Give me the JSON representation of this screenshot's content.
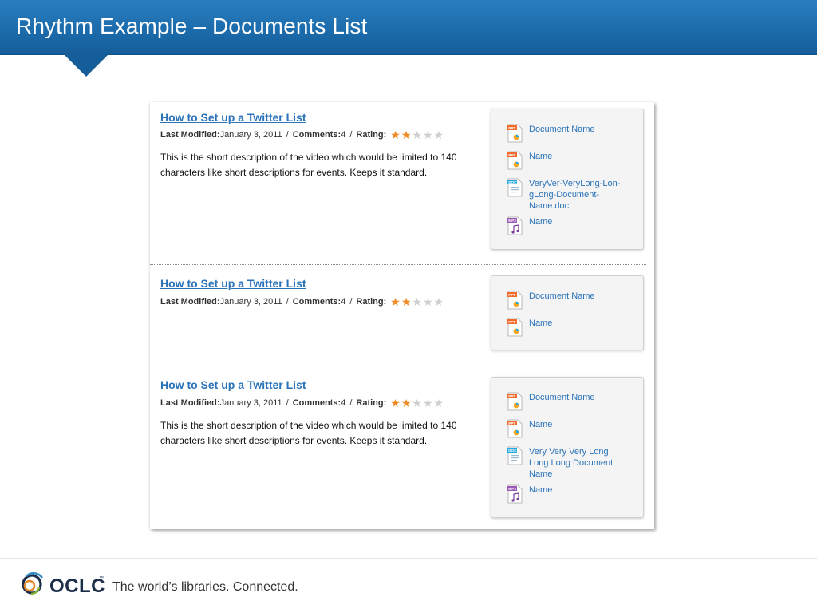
{
  "header": {
    "title": "Rhythm Example – Documents List"
  },
  "colors": {
    "header": "#1b6aaa",
    "link": "#2a73b8",
    "star_on": "#f08a24",
    "star_off": "#cfcfcf",
    "ppt": "#f26b2b",
    "doc": "#29a8e0",
    "mp3": "#9b59b6"
  },
  "items": [
    {
      "title": "How to Set up a Twitter List",
      "meta": {
        "modified_label": "Last Modified:",
        "modified_value": "January 3, 2011",
        "sep": "/",
        "comments_label": "Comments:",
        "comments_value": "4",
        "rating_label": "Rating:",
        "rating": 2,
        "rating_max": 5
      },
      "description": "This is the short description of the video which would be limited to 140 characters like short descriptions for events. Keeps it standard.",
      "documents": [
        {
          "type": "ppt",
          "icon": "ppt-file-icon",
          "badge": "PPT",
          "name": "Document Name"
        },
        {
          "type": "ppt",
          "icon": "ppt-file-icon",
          "badge": "PPT",
          "name": "Name"
        },
        {
          "type": "doc",
          "icon": "doc-file-icon",
          "badge": "DOC",
          "name": "VeryVer-VeryLong-Lon-gLong-Document-Name.doc"
        },
        {
          "type": "mp3",
          "icon": "mp3-file-icon",
          "badge": "MP3",
          "name": "Name"
        }
      ]
    },
    {
      "title": "How to Set up a Twitter List",
      "meta": {
        "modified_label": "Last Modified:",
        "modified_value": "January 3, 2011",
        "sep": "/",
        "comments_label": "Comments:",
        "comments_value": "4",
        "rating_label": "Rating:",
        "rating": 2,
        "rating_max": 5
      },
      "description": "",
      "documents": [
        {
          "type": "ppt",
          "icon": "ppt-file-icon",
          "badge": "PPT",
          "name": "Document Name"
        },
        {
          "type": "ppt",
          "icon": "ppt-file-icon",
          "badge": "PPT",
          "name": "Name"
        }
      ]
    },
    {
      "title": "How to Set up a Twitter List",
      "meta": {
        "modified_label": "Last Modified:",
        "modified_value": "January 3, 2011",
        "sep": "/",
        "comments_label": "Comments:",
        "comments_value": "4",
        "rating_label": "Rating:",
        "rating": 2,
        "rating_max": 5
      },
      "description": "This is the short description of the video which would be limited to 140 characters like short descriptions for events. Keeps it standard.",
      "documents": [
        {
          "type": "ppt",
          "icon": "ppt-file-icon",
          "badge": "PPT",
          "name": "Document Name"
        },
        {
          "type": "ppt",
          "icon": "ppt-file-icon",
          "badge": "PPT",
          "name": "Name"
        },
        {
          "type": "doc",
          "icon": "doc-file-icon",
          "badge": "DOC",
          "name": "Very Very Very Long Long Long Document Name"
        },
        {
          "type": "mp3",
          "icon": "mp3-file-icon",
          "badge": "MP3",
          "name": "Name"
        }
      ]
    }
  ],
  "footer": {
    "logo": "OCLC",
    "logo_tm": "™",
    "tagline": "The world’s libraries. Connected."
  }
}
